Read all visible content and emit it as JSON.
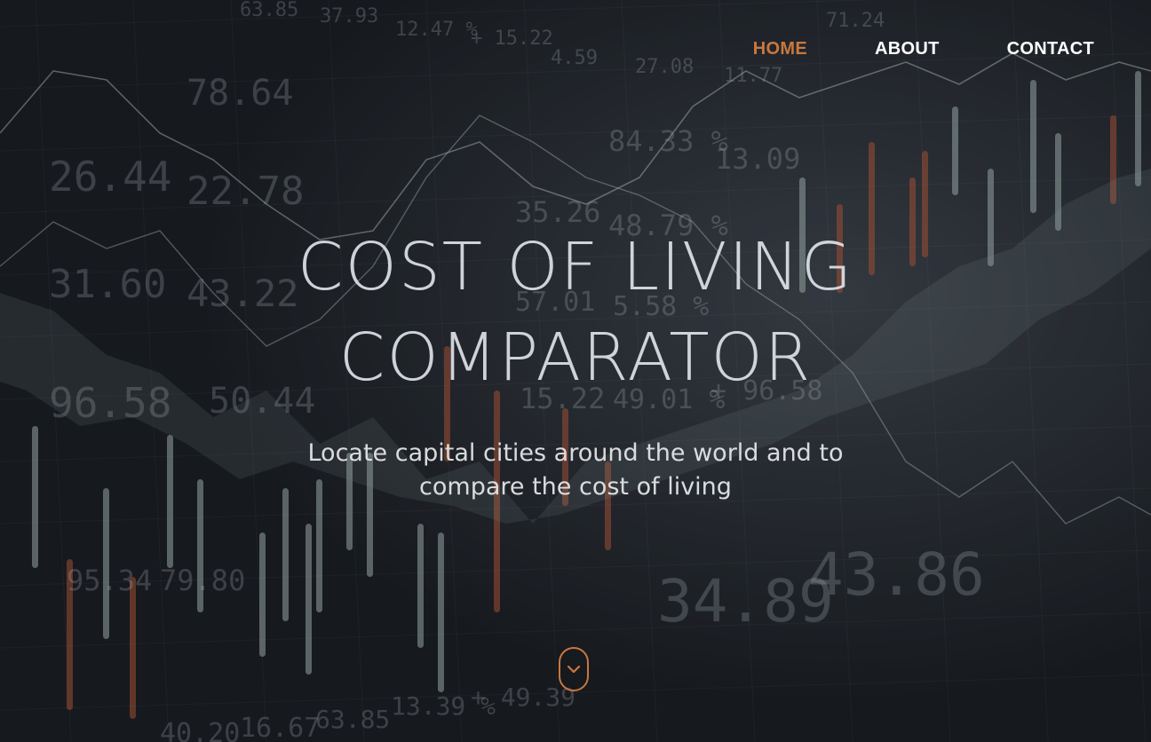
{
  "nav": {
    "items": [
      {
        "label": "HOME",
        "active": true
      },
      {
        "label": "ABOUT",
        "active": false
      },
      {
        "label": "CONTACT",
        "active": false
      }
    ]
  },
  "hero": {
    "title_line1": "COST OF LIVING",
    "title_line2": "COMPARATOR",
    "subtitle": "Locate capital cities around the world and to compare the cost of living"
  },
  "scroll": {
    "icon": "chevron-down-icon"
  },
  "colors": {
    "accent": "#c8783f",
    "nav_text": "#ffffff",
    "background": "#1d2126"
  },
  "background": {
    "numbers": [
      "63.85",
      "37.93",
      "12.47 %",
      "+ 15.22",
      "4.59",
      "27.08",
      "11.77",
      "71.24",
      "78.64",
      "84.33 %",
      "26.44",
      "22.78",
      "13.09",
      "35.26",
      "48.79 %",
      "31.60",
      "43.22",
      "57.01",
      "5.58 %",
      "96.58",
      "50.44",
      "15.22",
      "49.01 %",
      "+ 96.58",
      "34.89",
      "43.86",
      "95.34",
      "79.80",
      "63.85",
      "13.39 %",
      "+ 49.39",
      "16.67",
      "40.20"
    ]
  }
}
